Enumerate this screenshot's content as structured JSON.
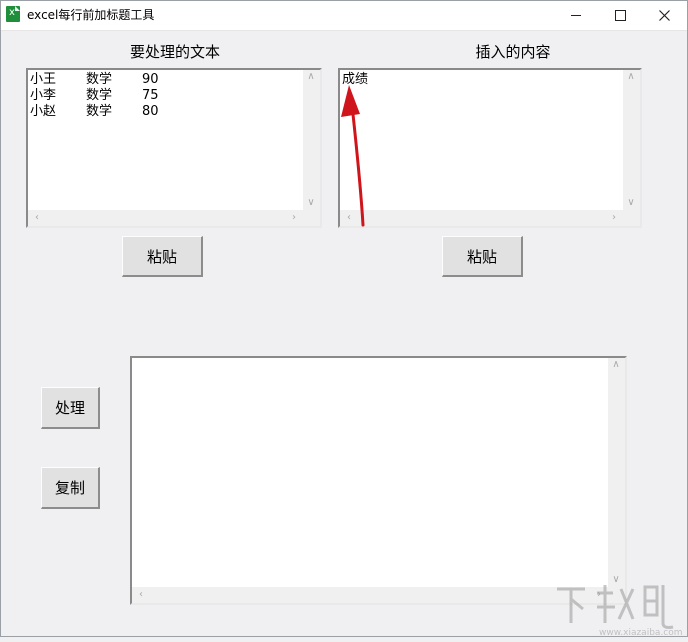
{
  "window": {
    "title": "excel每行前加标题工具",
    "icon": "excel-icon"
  },
  "left_panel": {
    "label": "要处理的文本",
    "rows": [
      [
        "小王",
        "数学",
        "90"
      ],
      [
        "小李",
        "数学",
        "75"
      ],
      [
        "小赵",
        "数学",
        "80"
      ]
    ],
    "paste_button": "粘贴"
  },
  "right_panel": {
    "label": "插入的内容",
    "content": "成绩",
    "paste_button": "粘贴"
  },
  "actions": {
    "process_button": "处理",
    "copy_button": "复制"
  },
  "output": {
    "content": ""
  },
  "annotation": {
    "arrow_color": "#d0141b"
  },
  "watermark": {
    "text": "下载吧",
    "url": "www.xiazaiba.com"
  }
}
